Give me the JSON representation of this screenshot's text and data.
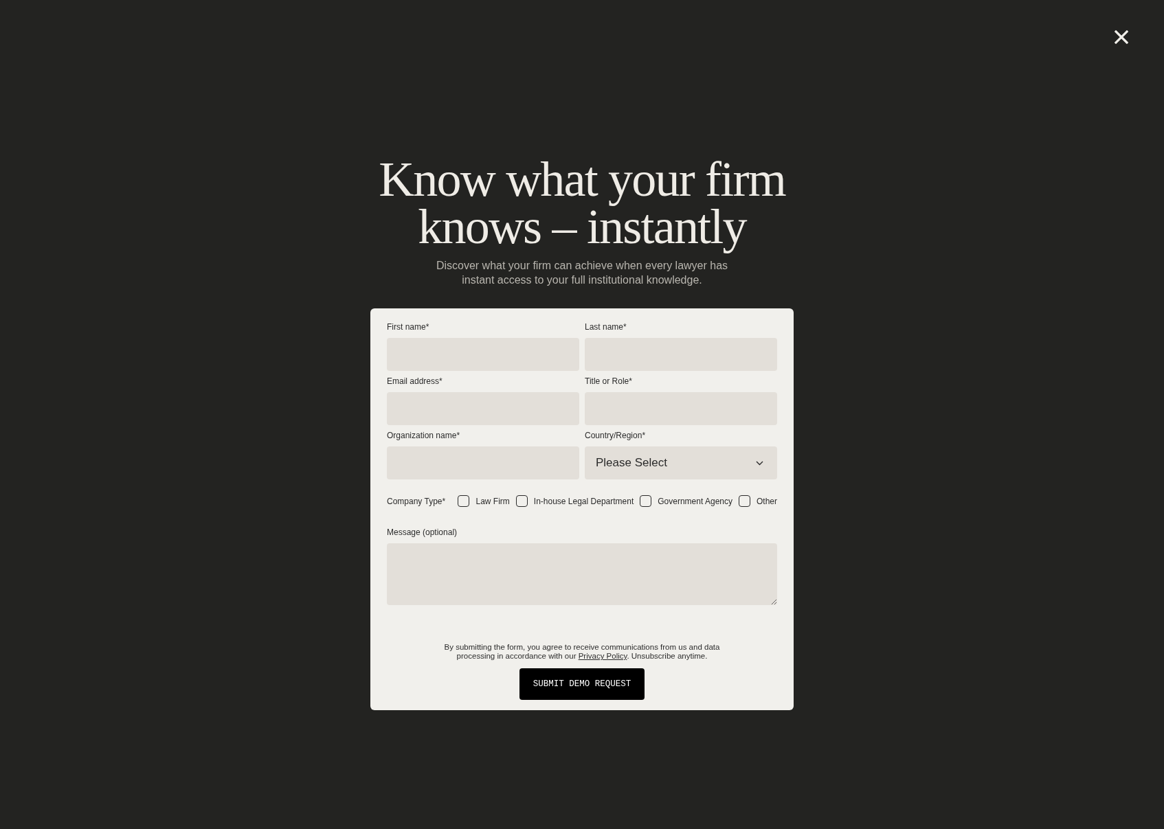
{
  "heading": "Know what your firm knows – instantly",
  "subtitle": "Discover what your firm can achieve when every lawyer has instant access to your full institutional knowledge.",
  "form": {
    "fields": [
      {
        "label": "First name*",
        "kind": "text"
      },
      {
        "label": "Last name*",
        "kind": "text"
      },
      {
        "label": "Email address*",
        "kind": "text"
      },
      {
        "label": "Title or Role*",
        "kind": "text"
      },
      {
        "label": "Organization name*",
        "kind": "text"
      },
      {
        "label": "Country/Region*",
        "kind": "select",
        "value": "Please Select"
      }
    ],
    "company_type": {
      "label": "Company Type*",
      "options": [
        {
          "label": "Law Firm",
          "checked": false
        },
        {
          "label": "In-house Legal Department",
          "checked": false
        },
        {
          "label": "Government Agency",
          "checked": false
        },
        {
          "label": "Other",
          "checked": false
        }
      ]
    },
    "message": {
      "label": "Message (optional)"
    },
    "consent": {
      "text_before": "By submitting the form, you agree to receive communications from us and data processing in accordance with our ",
      "link": "Privacy Policy",
      "text_after": ". Unsubscribe anytime."
    },
    "submit_button": "SUBMIT DEMO REQUEST"
  }
}
